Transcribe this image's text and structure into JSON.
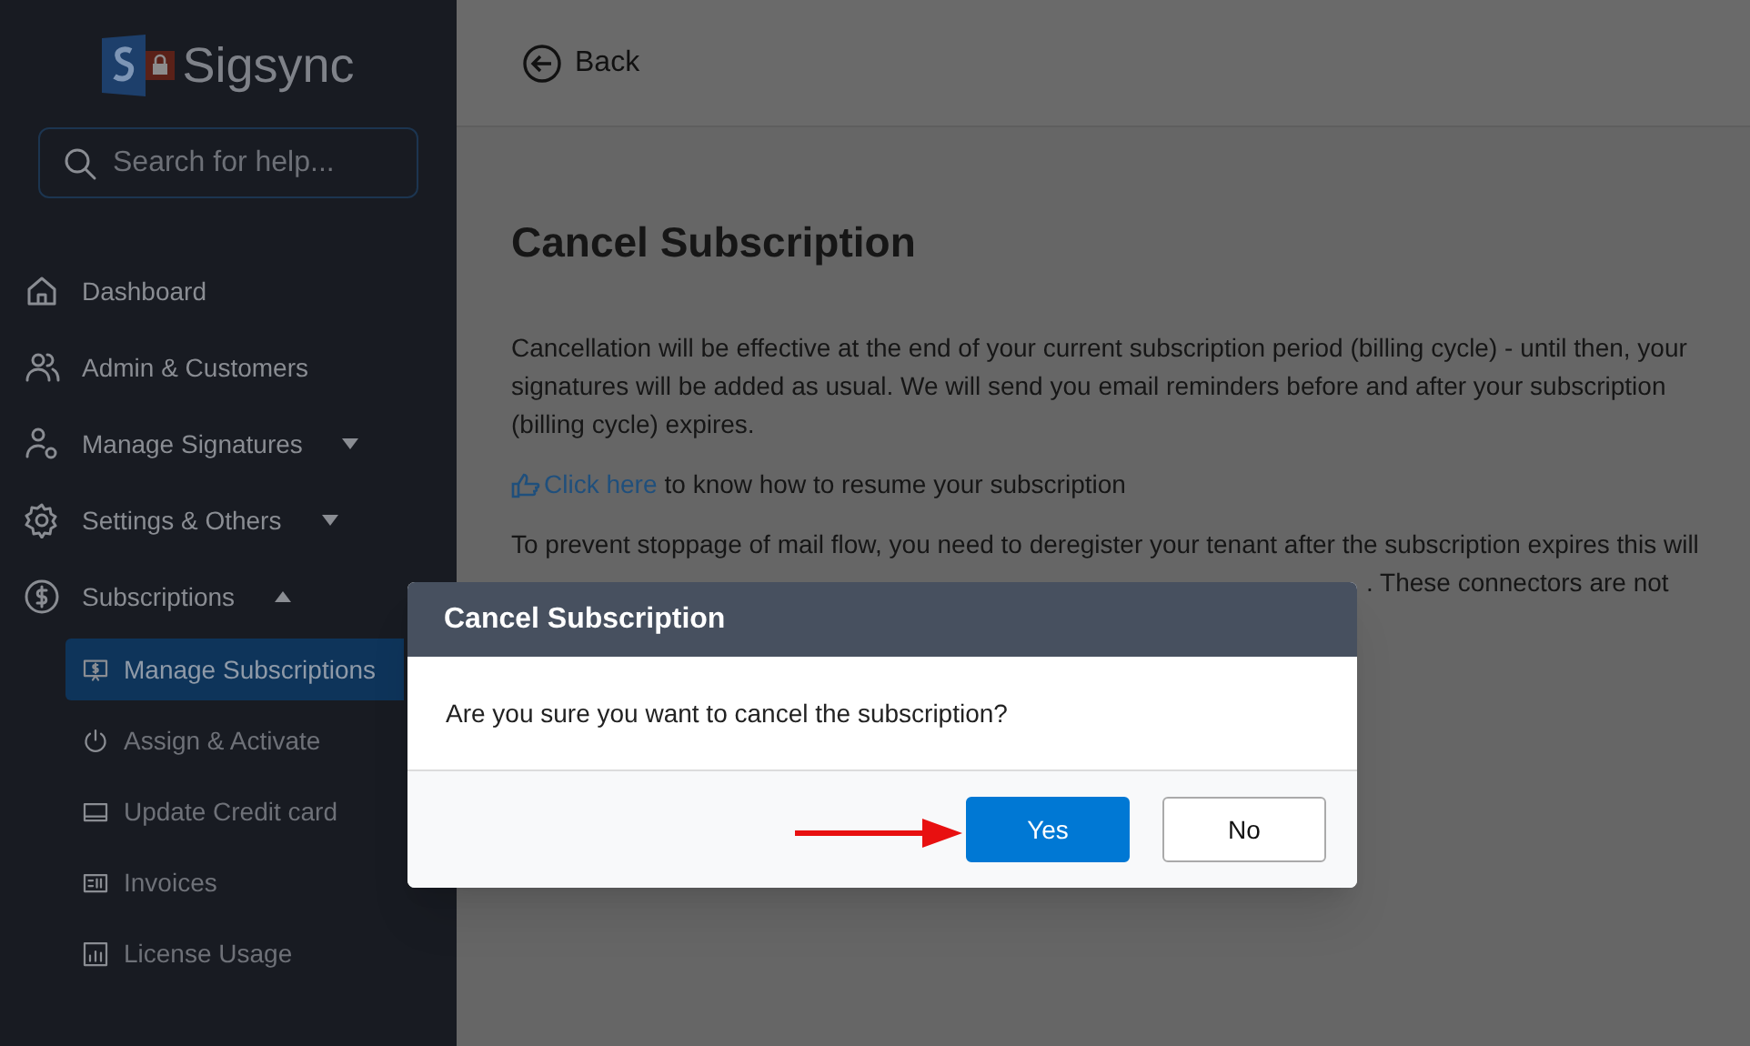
{
  "sidebar": {
    "brand": "Sigsync",
    "search": {
      "placeholder": "Search for help..."
    },
    "items": [
      {
        "label": "Dashboard"
      },
      {
        "label": "Admin & Customers"
      },
      {
        "label": "Manage Signatures",
        "expanded": false
      },
      {
        "label": "Settings & Others",
        "expanded": false
      },
      {
        "label": "Subscriptions",
        "expanded": true,
        "children": [
          {
            "label": "Manage Subscriptions",
            "selected": true
          },
          {
            "label": "Assign & Activate",
            "selected": false
          },
          {
            "label": "Update Credit card",
            "selected": false
          },
          {
            "label": "Invoices",
            "selected": false
          },
          {
            "label": "License Usage",
            "selected": false
          }
        ]
      }
    ]
  },
  "header": {
    "back": "Back"
  },
  "page": {
    "title": "Cancel Subscription",
    "paragraph_1": "Cancellation will be effective at the end of your current subscription period (billing cycle) - until then, your signatures will be added as usual. We will send you email reminders before and after your subscription (billing cycle) expires.",
    "link": "Click here",
    "link_rest": "to know how to resume your subscription",
    "paragraph_2_line_1": "To prevent stoppage of mail flow, you need to deregister your tenant after the subscription expires this will",
    "paragraph_2_visible_end": ". These connectors are not"
  },
  "dialog": {
    "title": "Cancel Subscription",
    "message": "Are you sure you want to cancel the subscription?",
    "buttons": [
      {
        "label": "Yes",
        "kind": "primary"
      },
      {
        "label": "No",
        "kind": "secondary"
      }
    ]
  }
}
